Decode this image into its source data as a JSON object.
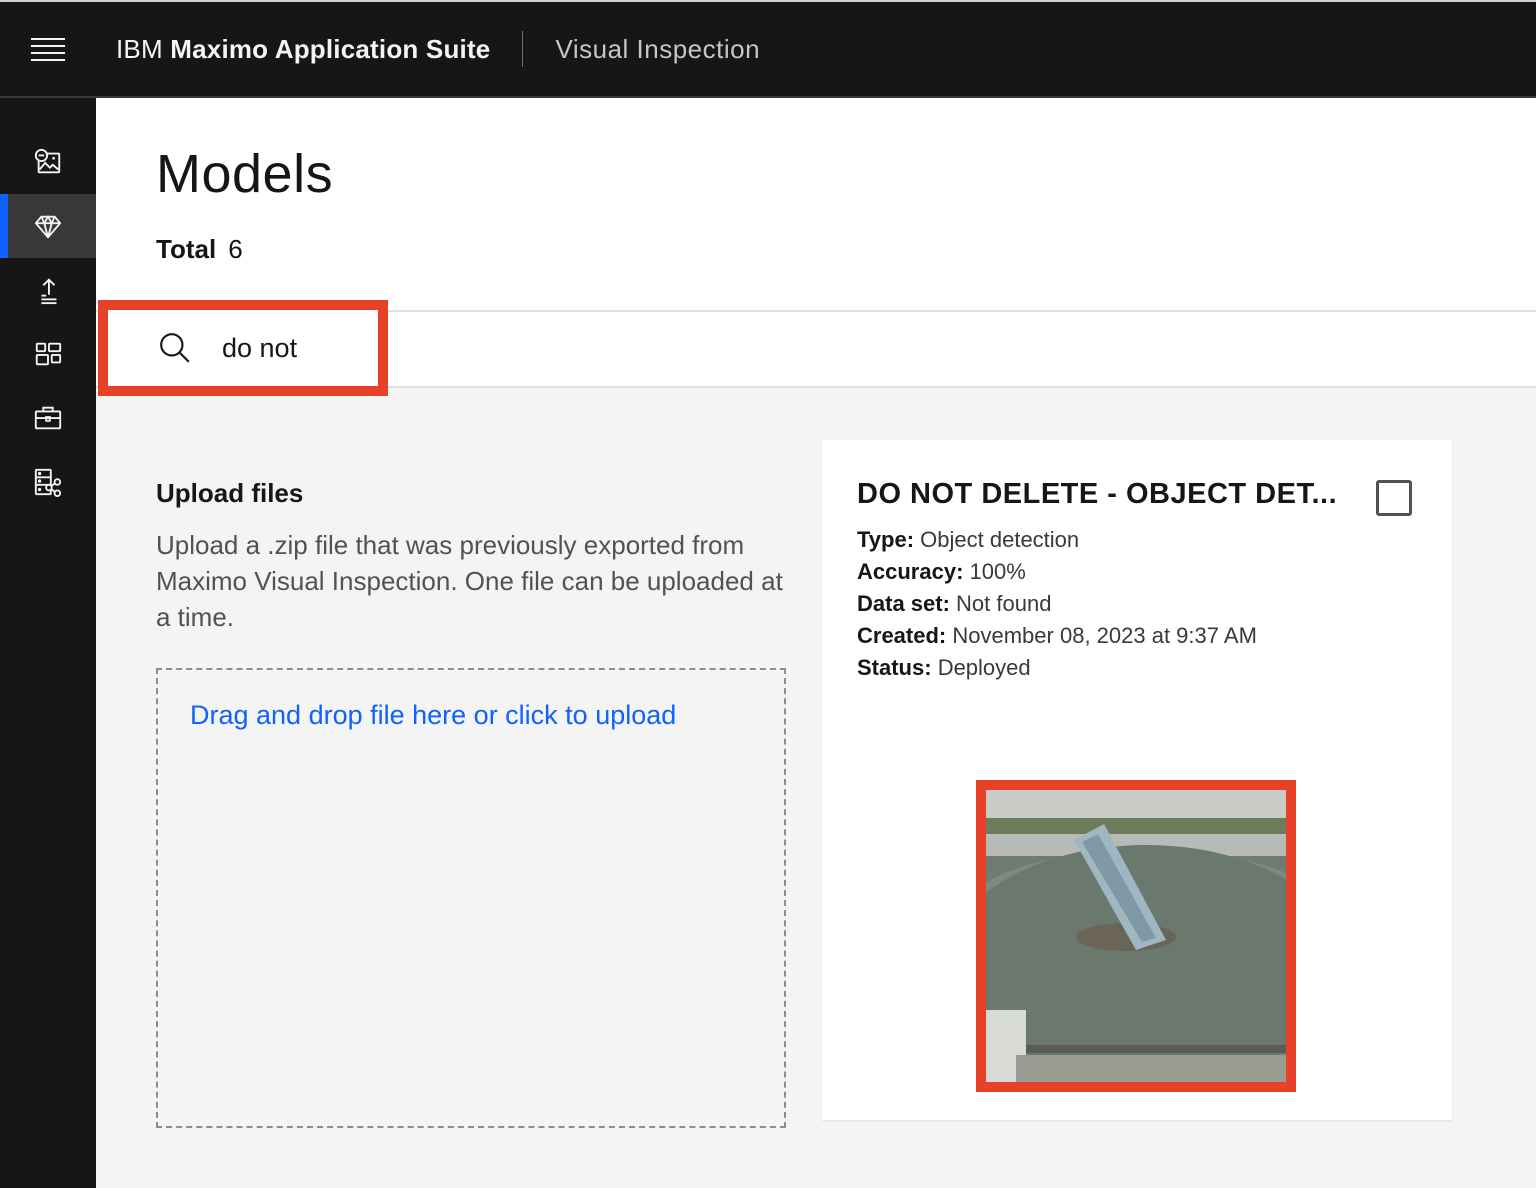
{
  "topbar": {
    "menu_icon": "hamburger-menu-icon",
    "brand_prefix": "IBM",
    "brand_name": "Maximo Application Suite",
    "product": "Visual Inspection"
  },
  "sidenav": {
    "items": [
      {
        "id": "datasets",
        "icon": "image-dataset-icon",
        "active": false
      },
      {
        "id": "models",
        "icon": "diamond-model-icon",
        "active": true
      },
      {
        "id": "deployed",
        "icon": "upload-deploy-icon",
        "active": false
      },
      {
        "id": "projects",
        "icon": "dashboard-grid-icon",
        "active": false
      },
      {
        "id": "inspections",
        "icon": "briefcase-icon",
        "active": false
      },
      {
        "id": "edge",
        "icon": "data-share-icon",
        "active": false
      }
    ]
  },
  "page": {
    "title": "Models",
    "total_label": "Total",
    "total_value": "6"
  },
  "search": {
    "value": "do not",
    "placeholder": "",
    "highlight_color": "#e8412a"
  },
  "upload": {
    "title": "Upload files",
    "description": "Upload a .zip file that was previously exported from Maximo Visual Inspection. One file can be uploaded at a time.",
    "dropzone_label": "Drag and drop file here or click to upload"
  },
  "models": [
    {
      "title": "DO NOT DELETE - OBJECT DETECTION",
      "title_display": "DO NOT DELETE - OBJECT DET...",
      "fields": [
        {
          "label": "Type:",
          "value": "Object detection"
        },
        {
          "label": "Accuracy:",
          "value": "100%"
        },
        {
          "label": "Data set:",
          "value": "Not found"
        },
        {
          "label": "Created:",
          "value": "November 08, 2023 at 9:37 AM"
        },
        {
          "label": "Status:",
          "value": "Deployed"
        }
      ],
      "selected": false,
      "thumbnail": "water-treatment-clarifier-image"
    }
  ],
  "colors": {
    "accent": "#0f62fe",
    "header_bg": "#161616",
    "highlight": "#e8412a"
  }
}
